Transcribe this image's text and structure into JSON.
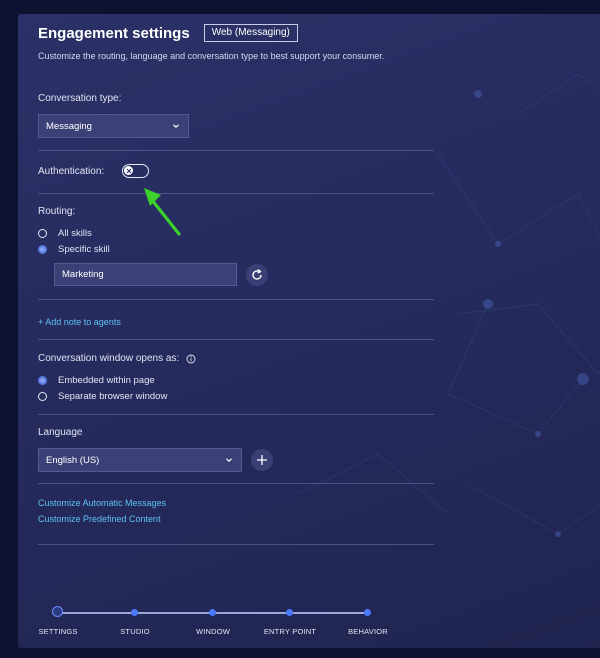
{
  "header": {
    "title": "Engagement settings",
    "badge": "Web (Messaging)",
    "subtitle": "Customize the routing, language and conversation type to best support your consumer."
  },
  "conversation_type": {
    "label": "Conversation type:",
    "selected": "Messaging"
  },
  "authentication": {
    "label": "Authentication:",
    "enabled": false
  },
  "routing": {
    "label": "Routing:",
    "options": [
      "All skills",
      "Specific skill"
    ],
    "selected_option": "Specific skill",
    "skill_value": "Marketing"
  },
  "add_note_link": "+ Add note to agents",
  "window_opens": {
    "label": "Conversation window opens as:",
    "options": [
      "Embedded within page",
      "Separate browser window"
    ],
    "selected_option": "Embedded within page"
  },
  "language": {
    "label": "Language",
    "selected": "English (US)"
  },
  "links": {
    "automatic_messages": "Customize Automatic Messages",
    "predefined_content": "Customize Predefined Content"
  },
  "stepper": {
    "steps": [
      "SETTINGS",
      "STUDIO",
      "WINDOW",
      "ENTRY POINT",
      "BEHAVIOR"
    ],
    "active_step": "SETTINGS"
  },
  "colors": {
    "panel_bg": "#2b3167",
    "link": "#5cc2f2",
    "accent": "#4a7bff",
    "annotation_arrow": "#39d12a"
  }
}
